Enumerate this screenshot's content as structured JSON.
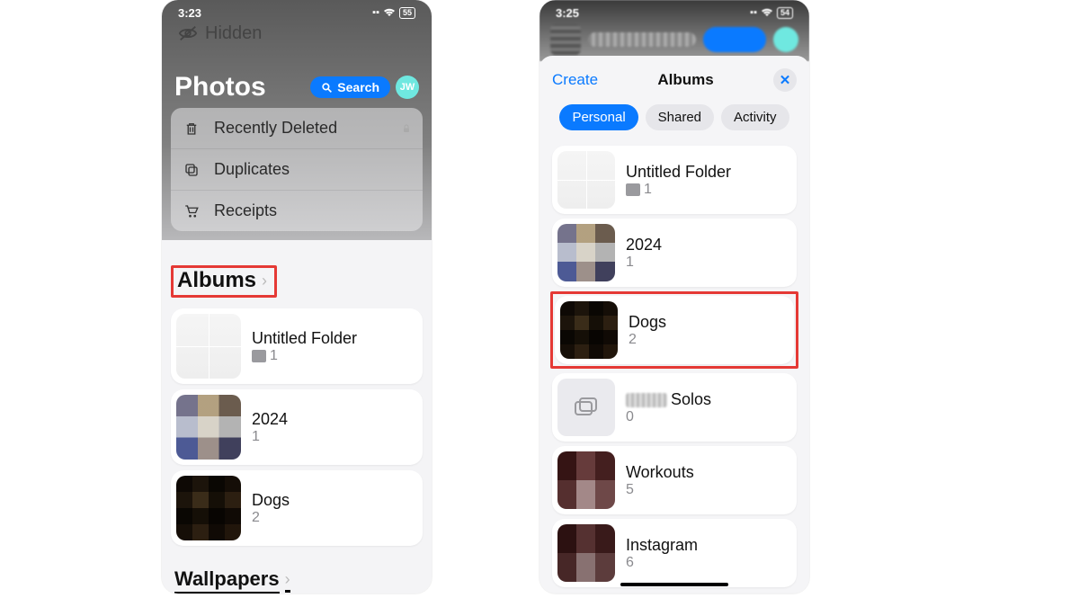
{
  "left": {
    "status": {
      "time": "3:23",
      "battery": "55"
    },
    "title": "Photos",
    "hidden_label": "Hidden",
    "search_label": "Search",
    "avatar_initials": "JW",
    "utility_rows": [
      {
        "label": "Recently Deleted",
        "icon": "trash",
        "trail": "lock"
      },
      {
        "label": "Duplicates",
        "icon": "duplicate",
        "trail": "blur"
      },
      {
        "label": "Receipts",
        "icon": "cart",
        "trail": "blur"
      }
    ],
    "albums_header": "Albums",
    "albums": [
      {
        "name": "Untitled Folder",
        "count": "1",
        "thumb": "plain",
        "folder": true
      },
      {
        "name": "2024",
        "count": "1",
        "thumb": "pix2"
      },
      {
        "name": "Dogs",
        "count": "2",
        "thumb": "pix"
      }
    ],
    "wallpapers_header": "Wallpapers"
  },
  "right": {
    "status": {
      "time": "3:25",
      "battery": "54"
    },
    "create_label": "Create",
    "sheet_title": "Albums",
    "segments": {
      "personal": "Personal",
      "shared": "Shared",
      "activity": "Activity"
    },
    "albums": [
      {
        "name": "Untitled Folder",
        "count": "1",
        "thumb": "plain",
        "folder": true
      },
      {
        "name": "2024",
        "count": "1",
        "thumb": "pix2"
      },
      {
        "name": "Dogs",
        "count": "2",
        "thumb": "pix",
        "highlight": true
      },
      {
        "name": "Solos",
        "count": "0",
        "thumb": "shared",
        "blur_prefix": true
      },
      {
        "name": "Workouts",
        "count": "5",
        "thumb": "pix3"
      },
      {
        "name": "Instagram",
        "count": "6",
        "thumb": "pix3"
      }
    ]
  }
}
